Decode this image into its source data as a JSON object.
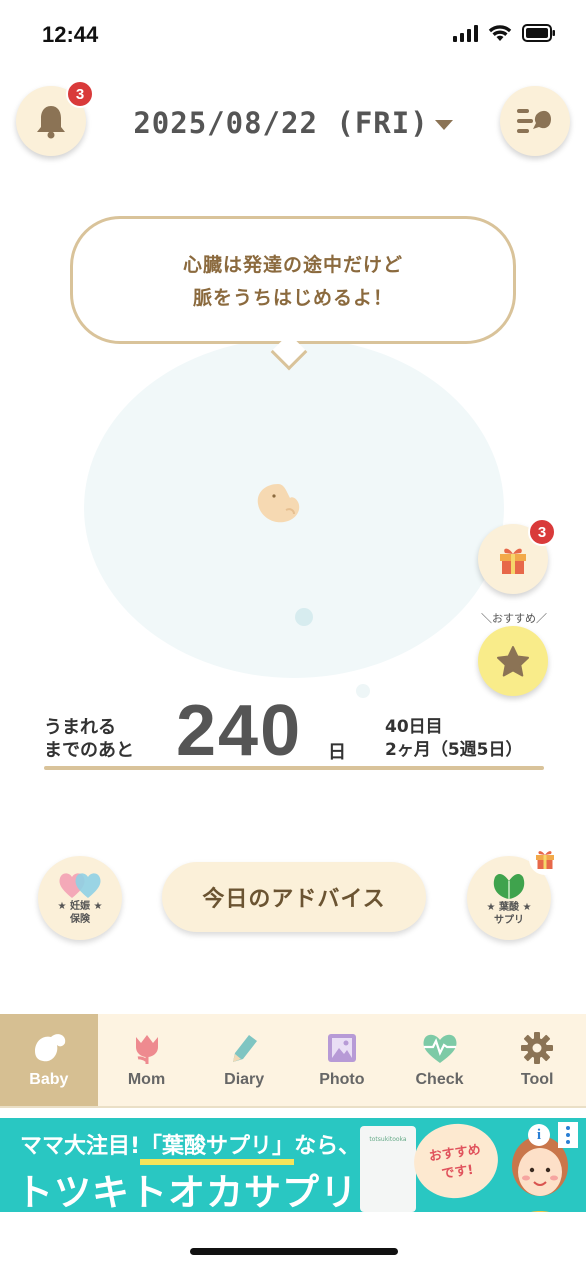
{
  "status": {
    "time": "12:44"
  },
  "header": {
    "date": "2025/08/22 (FRI)",
    "notification_count": "3"
  },
  "message": {
    "line1": "心臓は発達の途中だけど",
    "line2": "脈をうちはじめるよ！"
  },
  "side": {
    "gift_count": "3",
    "recommend_label": "＼おすすめ／"
  },
  "countdown": {
    "prefix_line1": "うまれる",
    "prefix_line2": "までのあと",
    "days": "240",
    "unit": "日",
    "info_line1": "40日目",
    "info_line2": "2ヶ月（5週5日）"
  },
  "features": {
    "insurance_line1": "★ 妊娠 ★",
    "insurance_line2": "保険",
    "advice": "今日のアドバイス",
    "supplement_line1": "★ 葉酸 ★",
    "supplement_line2": "サプリ"
  },
  "tabs": [
    {
      "label": "Baby",
      "icon": "bird-icon"
    },
    {
      "label": "Mom",
      "icon": "tulip-icon"
    },
    {
      "label": "Diary",
      "icon": "pencil-icon"
    },
    {
      "label": "Photo",
      "icon": "photo-icon"
    },
    {
      "label": "Check",
      "icon": "heartbeat-icon"
    },
    {
      "label": "Tool",
      "icon": "gear-icon"
    }
  ],
  "ad": {
    "line1_pre": "ママ大注目!",
    "line1_highlight": "「葉酸サプリ」",
    "line1_post": "なら、",
    "line2": "トツキトオカサプリ!",
    "bubble_line1": "おすすめ",
    "bubble_line2": "です!",
    "product_text": "totsukitooka",
    "info": "i"
  },
  "colors": {
    "accent": "#d6bf92",
    "badge": "#d93a3a",
    "ad_bg": "#29c7c2"
  }
}
